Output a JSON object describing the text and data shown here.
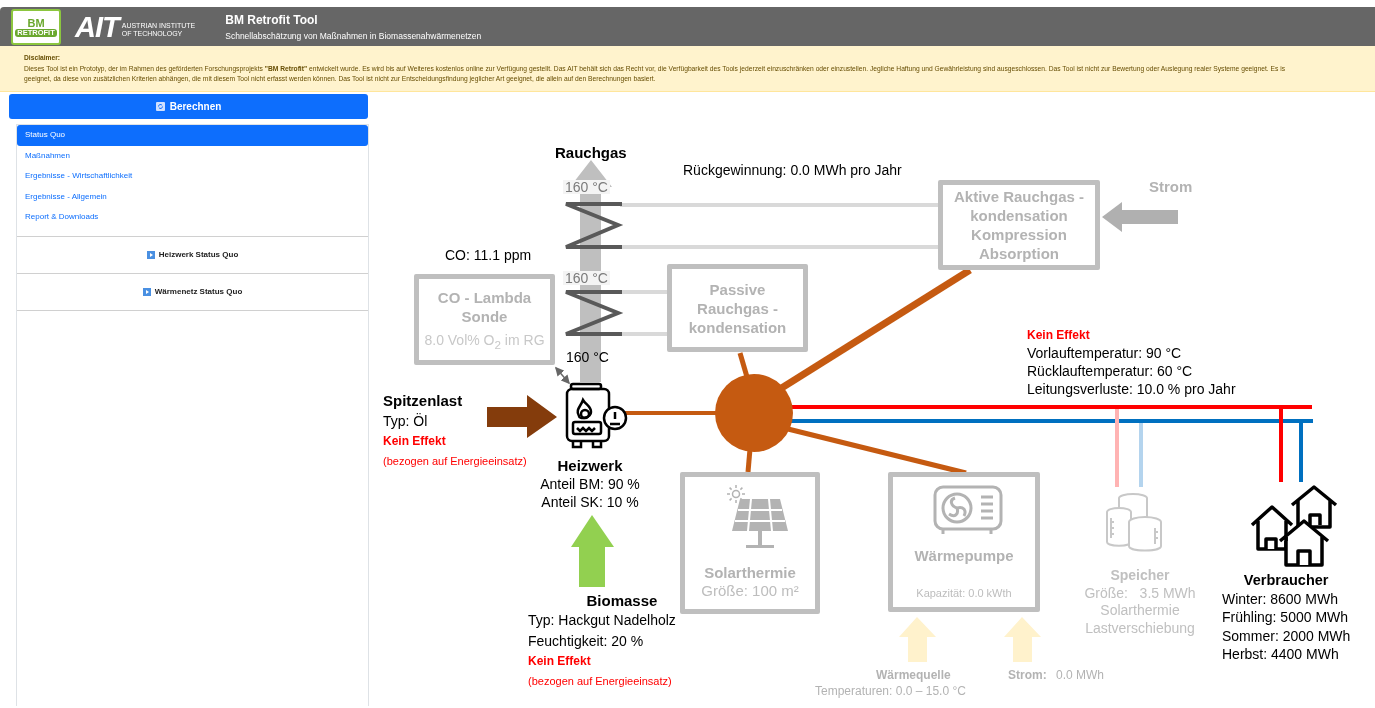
{
  "header": {
    "logo_bm": {
      "top": "BM",
      "bottom": "RETROFIT"
    },
    "logo_ait": {
      "mark": "AIT",
      "tagline_1": "AUSTRIAN INSTITUTE",
      "tagline_2": "OF TECHNOLOGY"
    },
    "title": "BM Retrofit Tool",
    "subtitle": "Schnellabschätzung von Maßnahmen in Biomassenahwärmenetzen"
  },
  "disclaimer": {
    "heading": "Disclaimer:",
    "lines": [
      "Dieses Tool ist ein Prototyp, der im Rahmen des geförderten Forschungsprojekts **\"BM Retrofit\"** entwickelt wurde. Es wird bis auf Weiteres kostenlos online zur Verfügung gestellt. Das AIT behält sich das Recht vor, die Verfügbarkeit des Tools jederzeit einzuschränken oder einzustellen. Jegliche Haftung und Gewährleistung sind ausgeschlossen. Das Tool ist nicht zur Bewertung oder Auslegung realer Systeme geeignet. Es is",
      "geeignet, da diese von zusätzlichen Kriterien abhängen, die mit diesem Tool nicht erfasst werden können. Das Tool ist nicht zur Entscheidungsfindung jeglicher Art geeignet, die allein auf den Berechnungen basiert."
    ]
  },
  "sidebar": {
    "calculate_button": "Berechnen",
    "nav_items": [
      {
        "label": "Status Quo",
        "selected": true
      },
      {
        "label": "Maßnahmen",
        "selected": false
      },
      {
        "label": "Ergebnisse - Wirtschaftlichkeit",
        "selected": false
      },
      {
        "label": "Ergebnisse - Allgemein",
        "selected": false
      },
      {
        "label": "Report & Downloads",
        "selected": false
      }
    ],
    "sections": [
      {
        "label": "Heizwerk Status Quo"
      },
      {
        "label": "Wärmenetz Status Quo"
      }
    ]
  },
  "diagram": {
    "flue_gas": {
      "title": "Rauchgas",
      "temp_top": "160 °C",
      "temp_middle": "160 °C",
      "temp_bottom": "160 °C"
    },
    "recovery": "Rückgewinnung: 0.0 MWh pro Jahr",
    "active_condensation": {
      "lines": [
        "Aktive Rauchgas -",
        "kondensation",
        "Kompression",
        "Absorption"
      ],
      "power_label": "Strom"
    },
    "co_reading": "CO: 11.1 ppm",
    "lambda_probe": {
      "lines": [
        "CO - Lambda",
        "Sonde"
      ],
      "reading": "8.0 Vol% O$_{2}$ im RG"
    },
    "passive_condensation": {
      "lines": [
        "Passive",
        "Rauchgas -",
        "kondensation"
      ]
    },
    "peak_load": {
      "title": "Spitzenlast",
      "type": "Typ: Öl",
      "effect": "Kein Effekt",
      "note": "(bezogen auf Energieeinsatz)"
    },
    "plant": {
      "title": "Heizwerk",
      "lines": [
        "Anteil BM: 90 %",
        "Anteil SK: 10 %"
      ]
    },
    "biomass": {
      "title": "Biomasse",
      "type": "Typ: Hackgut Nadelholz",
      "moisture": "Feuchtigkeit: 20 %",
      "effect": "Kein Effekt",
      "note": "(bezogen auf Energieeinsatz)"
    },
    "network": {
      "effect": "Kein Effekt",
      "lines": [
        "Vorlauftemperatur: 90 °C",
        "Rücklauftemperatur: 60 °C",
        "Leitungsverluste: 10.0 % pro Jahr"
      ]
    },
    "solar_thermal": {
      "title": "Solarthermie",
      "size": "Größe: 100 m²"
    },
    "heat_pump": {
      "title": "Wärmepumpe",
      "capacity": "Kapazität: 0.0 kWth",
      "source_label": "Wärmequelle",
      "source_temps": "Temperaturen: 0.0 – 15.0 °C",
      "power_label": "Strom:",
      "power_value": "0.0 MWh"
    },
    "storage": {
      "title": "Speicher",
      "size": "Größe:   3.5 MWh",
      "lines": [
        "Solarthermie",
        "Lastverschiebung"
      ]
    },
    "consumers": {
      "title": "Verbraucher",
      "lines": [
        "Winter: 8600 MWh",
        "Frühling: 5000 MWh",
        "Sommer: 2000 MWh",
        "Herbst: 4400 MWh"
      ]
    }
  }
}
